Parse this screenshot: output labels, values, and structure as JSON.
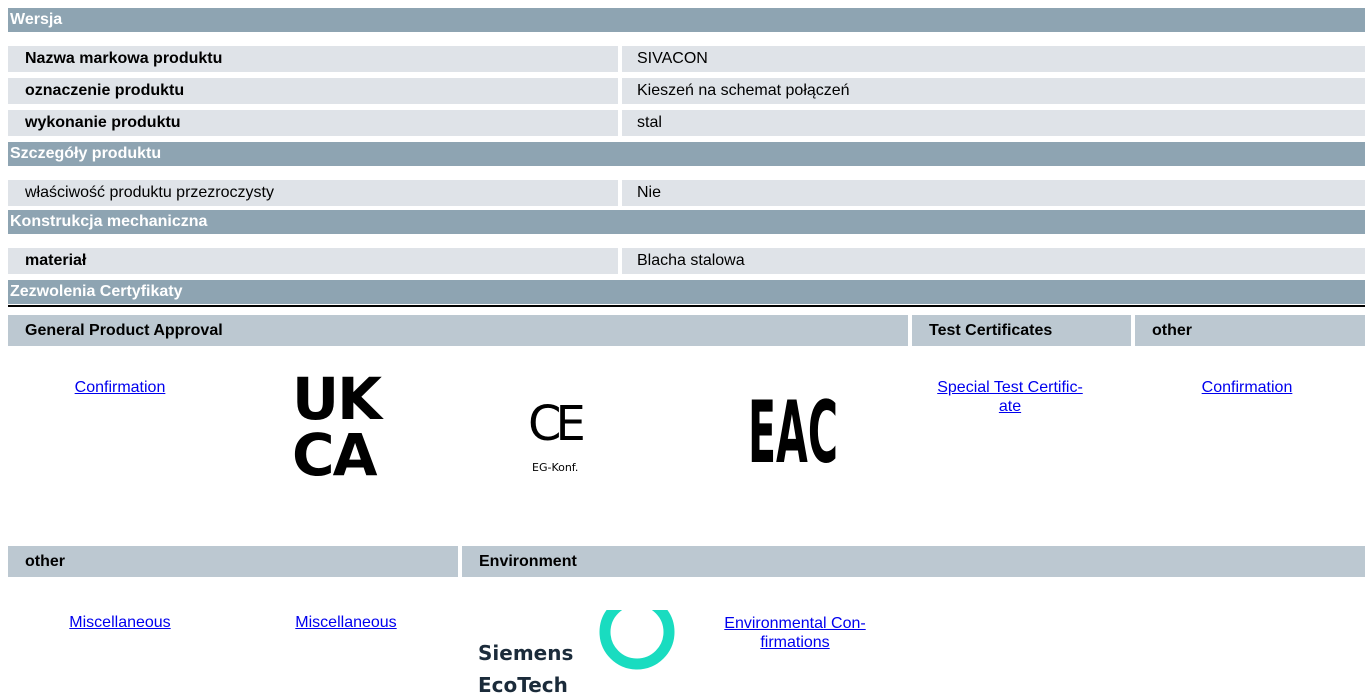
{
  "sections": {
    "wersja": "Wersja",
    "szczegoly": "Szczegóły produktu",
    "konstrukcja": "Konstrukcja mechaniczna",
    "zezwolenia": "Zezwolenia Certyfikaty"
  },
  "rows": {
    "marka": {
      "label": "Nazwa markowa produktu",
      "value": "SIVACON"
    },
    "oznaczenie": {
      "label": "oznaczenie produktu",
      "value": "Kieszeń na schemat połączeń"
    },
    "wykonanie": {
      "label": "wykonanie produktu",
      "value": "stal"
    },
    "przezroczysty": {
      "label": "właściwość produktu przezroczysty",
      "value": "Nie"
    },
    "material": {
      "label": "materiał",
      "value": "Blacha stalowa"
    }
  },
  "certs_header": {
    "general": "General Product Approval",
    "test": "Test Certificates",
    "other": "other"
  },
  "certs_links": {
    "confirmation_1": "Confirmation",
    "special_line1": "Special Test Certific-",
    "special_line2": "ate",
    "confirmation_2": "Confirmation"
  },
  "logos": {
    "ukca_line1": "UK",
    "ukca_line2": "CA",
    "ce_mark": "CE",
    "ce_caption": "EG-Konf.",
    "eac": "EAC",
    "ecotech_line1": "Siemens",
    "ecotech_line2": "EcoTech",
    "ecotech_accent": "#19dcc0"
  },
  "env_header": {
    "other": "other",
    "environment": "Environment"
  },
  "env_links": {
    "misc_1": "Miscellaneous",
    "misc_2": "Miscellaneous",
    "envconf_line1": "Environmental Con-",
    "envconf_line2": "firmations"
  }
}
